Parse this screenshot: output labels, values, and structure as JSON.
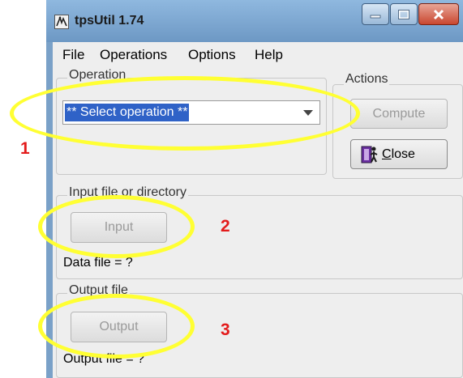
{
  "window": {
    "title": "tpsUtil 1.74"
  },
  "menu": [
    "File",
    "Operations",
    "Options",
    "Help"
  ],
  "operation": {
    "legend": "Operation",
    "selected": "** Select operation **"
  },
  "actions": {
    "legend": "Actions",
    "compute": "Compute",
    "close_u": "C",
    "close_rest": "lose"
  },
  "input": {
    "legend": "Input file or directory",
    "button": "Input",
    "status": "Data file = ?"
  },
  "output": {
    "legend": "Output file",
    "button": "Output",
    "status": "Output file = ?"
  },
  "annotations": {
    "n1": "1",
    "n2": "2",
    "n3": "3"
  },
  "colors": {
    "highlight": "#ffff33",
    "annotation_number": "#e31b1b",
    "selection": "#2f62c7"
  },
  "icons": {
    "app": "tpsutil-app-icon",
    "minimize": "minimize-icon",
    "maximize": "maximize-icon",
    "close": "close-icon",
    "close_button": "door-exit-icon",
    "dropdown": "chevron-down-icon"
  }
}
